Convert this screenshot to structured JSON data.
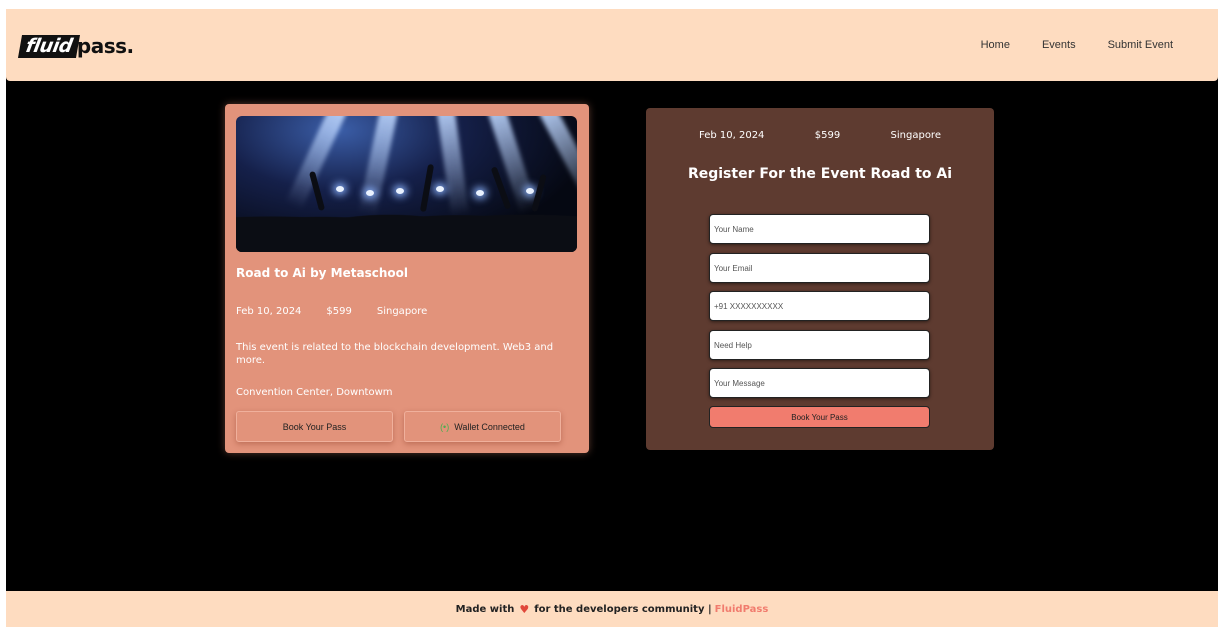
{
  "nav": {
    "logo_box": "fluid",
    "logo_rest": "pass.",
    "links": [
      "Home",
      "Events",
      "Submit Event"
    ]
  },
  "event": {
    "title": "Road to Ai by Metaschool",
    "date": "Feb 10, 2024",
    "price": "$599",
    "location": "Singapore",
    "description": "This event is related to the blockchain development. Web3 and more.",
    "venue": "Convention Center, Downtowm",
    "book_label": "Book Your Pass",
    "wallet_icon": "(•)",
    "wallet_label": "Wallet Connected"
  },
  "register": {
    "date": "Feb 10, 2024",
    "price": "$599",
    "location": "Singapore",
    "title": "Register For the Event Road to Ai",
    "placeholders": {
      "name": "Your Name",
      "email": "Your Email",
      "phone": "+91 XXXXXXXXXX",
      "help": "Need Help",
      "message": "Your Message"
    },
    "submit_label": "Book Your Pass"
  },
  "footer": {
    "prefix": "Made with",
    "heart": "♥",
    "suffix": "for the developers community |",
    "brand": "FluidPass"
  },
  "colors": {
    "nav_bg": "#fedcc0",
    "card_bg": "#e2937b",
    "panel_bg": "#5e3b30",
    "accent": "#f17c6e"
  }
}
